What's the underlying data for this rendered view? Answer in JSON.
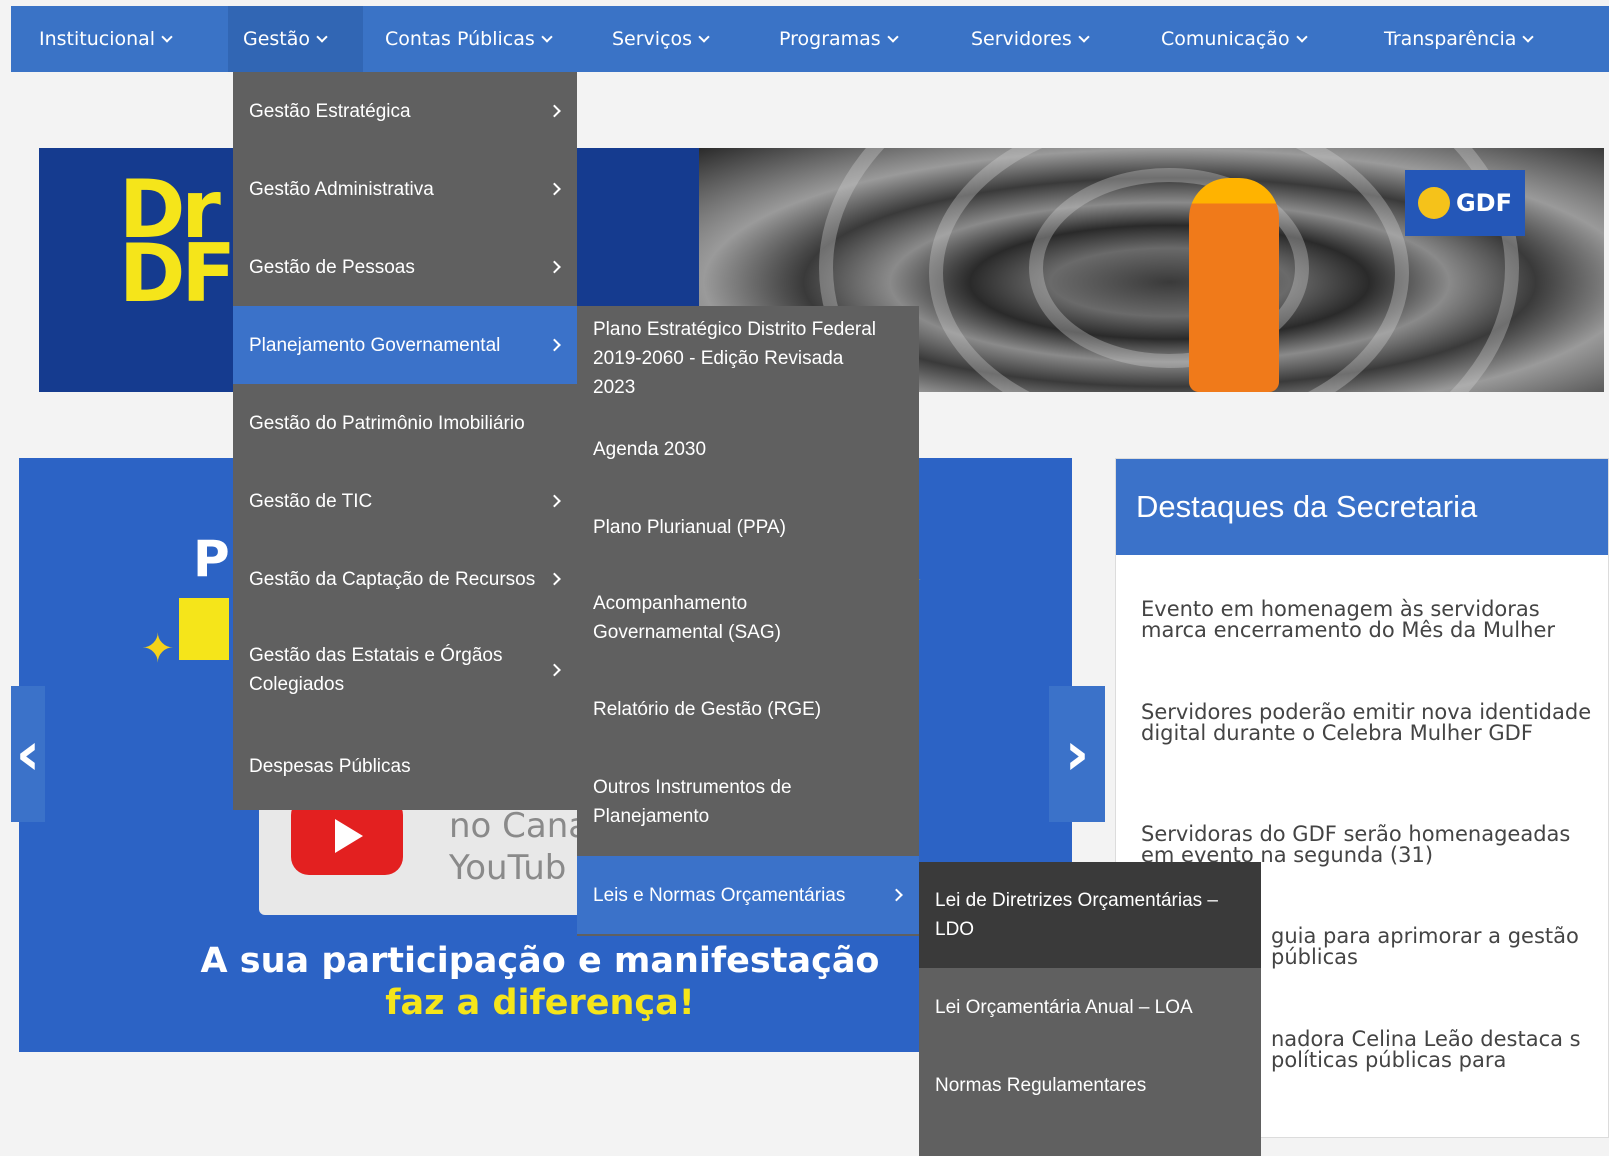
{
  "nav": {
    "items": [
      {
        "label": "Institucional"
      },
      {
        "label": "Gestão"
      },
      {
        "label": "Contas Públicas"
      },
      {
        "label": "Serviços"
      },
      {
        "label": "Programas"
      },
      {
        "label": "Servidores"
      },
      {
        "label": "Comunicação"
      },
      {
        "label": "Transparência"
      }
    ]
  },
  "menu_gestao": {
    "items": [
      {
        "label": "Gestão Estratégica"
      },
      {
        "label": "Gestão Administrativa"
      },
      {
        "label": "Gestão de Pessoas"
      },
      {
        "label": "Planejamento Governamental"
      },
      {
        "label": "Gestão do Patrimônio Imobiliário"
      },
      {
        "label": "Gestão de TIC"
      },
      {
        "label": "Gestão da Captação de Recursos"
      },
      {
        "label": "Gestão das Estatais e Órgãos Colegiados"
      },
      {
        "label": "Despesas Públicas"
      }
    ]
  },
  "menu_planejamento": {
    "items": [
      {
        "label": "Plano Estratégico Distrito Federal 2019-2060 - Edição Revisada 2023"
      },
      {
        "label": "Agenda 2030"
      },
      {
        "label": "Plano Plurianual (PPA)"
      },
      {
        "label": "Acompanhamento Governamental (SAG)"
      },
      {
        "label": "Relatório de Gestão (RGE)"
      },
      {
        "label": "Outros Instrumentos de Planejamento"
      },
      {
        "label": "Leis e Normas Orçamentárias"
      }
    ]
  },
  "menu_leis": {
    "items": [
      {
        "label": "Lei de Diretrizes Orçamentárias – LDO"
      },
      {
        "label": "Lei Orçamentária Anual – LOA"
      },
      {
        "label": "Normas Regulamentares"
      }
    ]
  },
  "banner": {
    "headline_fragment": "Dr\nDF",
    "logo_text": "GDF"
  },
  "carousel": {
    "title_fragment": "P",
    "yt_text": "no Cana\nYouTub",
    "tagline_white": "A sua participação e manifestação",
    "tagline_yellow": "faz a diferença!"
  },
  "highlights": {
    "title": "Destaques da Secretaria",
    "items": [
      {
        "text": "Evento em homenagem às servidoras marca encerramento do Mês da Mulher"
      },
      {
        "text": "Servidores poderão emitir nova identidade digital durante o Celebra Mulher GDF"
      },
      {
        "text": "Servidoras do GDF serão homenageadas em evento na segunda (31)"
      },
      {
        "text": "guia para aprimorar a gestão públicas"
      },
      {
        "text": "nadora Celina Leão destaca s políticas públicas para"
      }
    ]
  },
  "colors": {
    "nav_blue": "#3a73c6",
    "menu_gray": "#606060",
    "highlight_blue": "#3b72c9",
    "yellow": "#f5e51a"
  }
}
